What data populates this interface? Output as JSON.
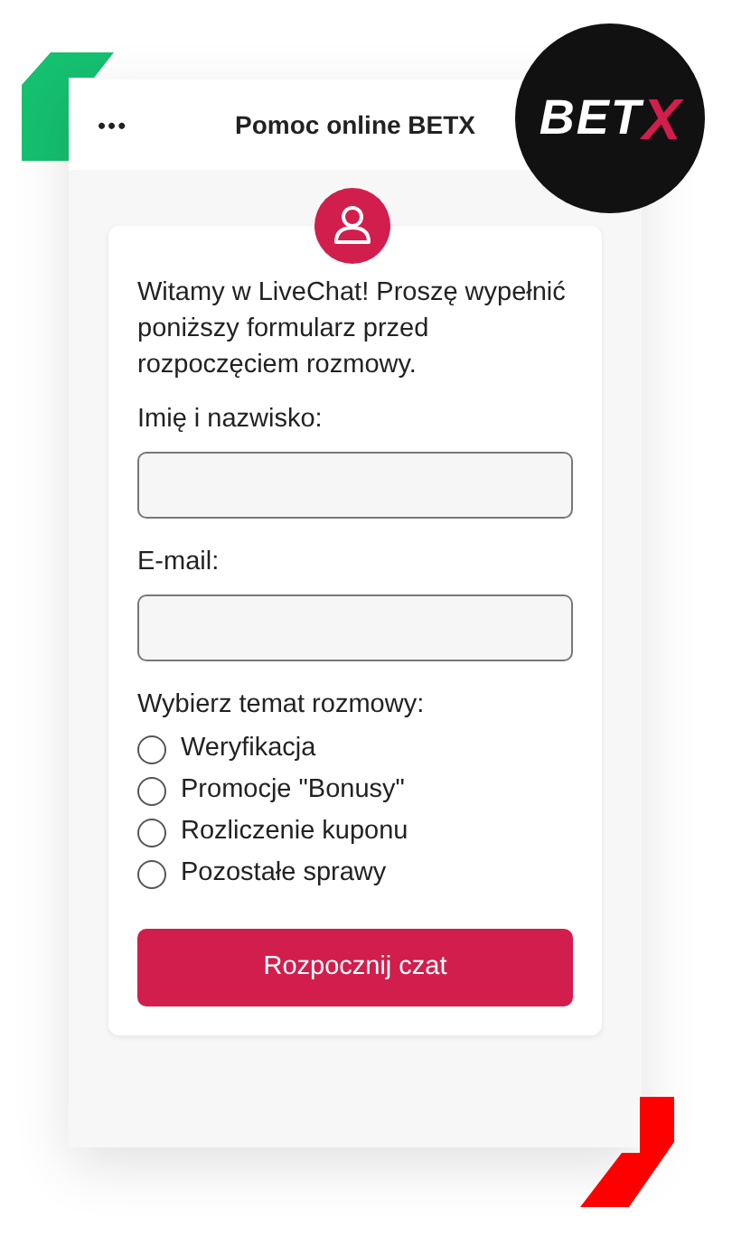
{
  "header": {
    "menu_icon": "•••",
    "title": "Pomoc online BETX"
  },
  "logo": {
    "text": "BET",
    "accent": "X"
  },
  "form": {
    "intro": "Witamy w LiveChat! Proszę wypełnić poniższy formularz przed rozpoczęciem rozmowy.",
    "fields": [
      {
        "label": "Imię i nazwisko:"
      },
      {
        "label": "E-mail:"
      }
    ],
    "topic_label": "Wybierz temat rozmowy:",
    "topics": [
      {
        "label": "Weryfikacja",
        "selected": false
      },
      {
        "label": "Promocje \"Bonusy\"",
        "selected": false
      },
      {
        "label": "Rozliczenie kuponu",
        "selected": false
      },
      {
        "label": "Pozostałe sprawy",
        "selected": false
      }
    ],
    "submit": "Rozpocznij czat"
  }
}
